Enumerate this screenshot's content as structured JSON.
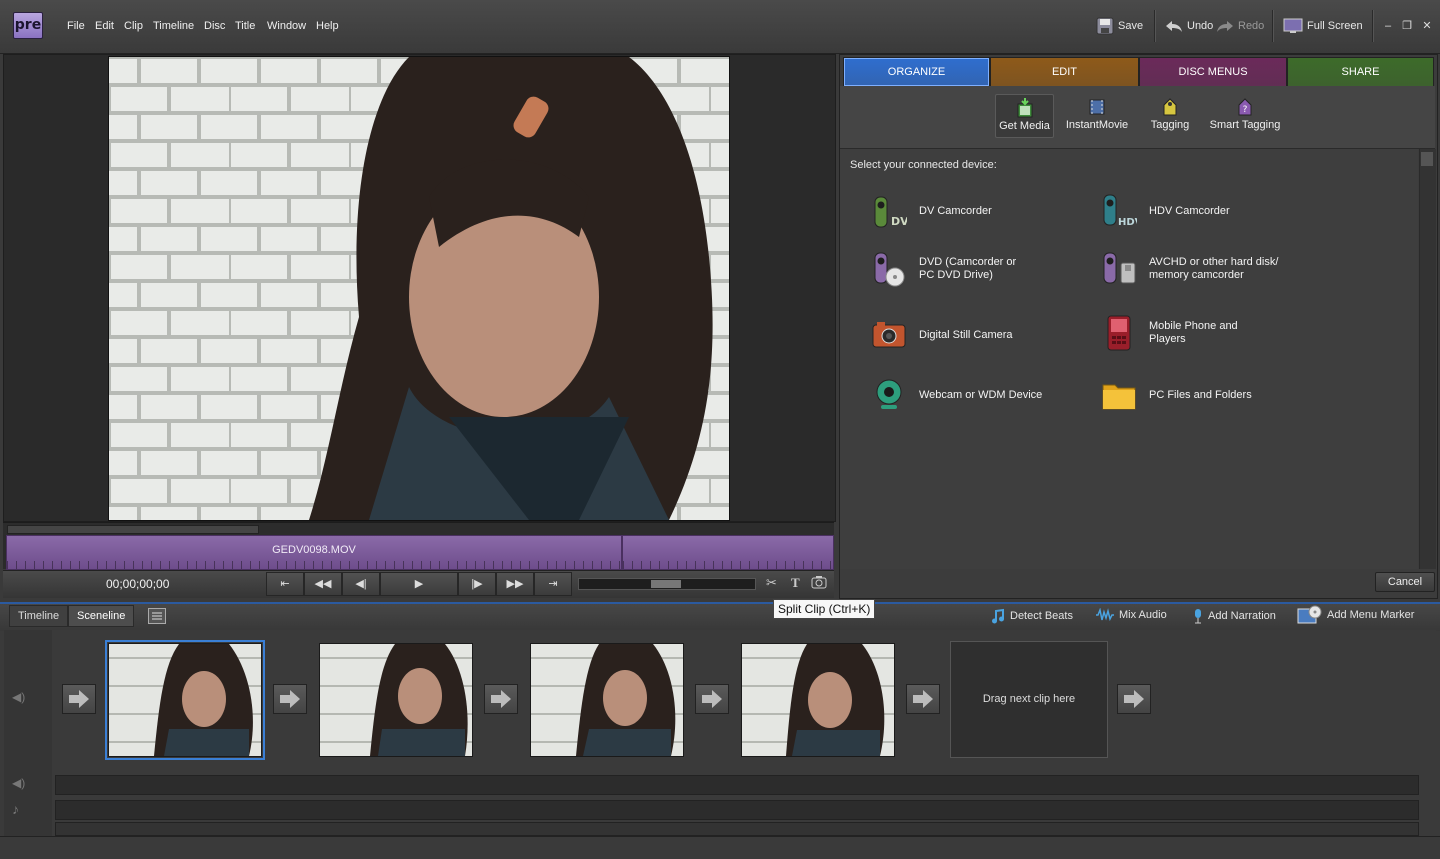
{
  "app": {
    "logo_text": "pre"
  },
  "menu": [
    "File",
    "Edit",
    "Clip",
    "Timeline",
    "Disc",
    "Title",
    "Window",
    "Help"
  ],
  "toolbar": {
    "save": "Save",
    "undo": "Undo",
    "redo": "Redo",
    "fullscreen": "Full Screen"
  },
  "monitor": {
    "clip_name": "GEDV0098.MOV",
    "timecode": "00;00;00;00"
  },
  "tabs": [
    {
      "label": "ORGANIZE",
      "color": "#2f6ecf",
      "active": true
    },
    {
      "label": "EDIT",
      "color": "#8e5a1a"
    },
    {
      "label": "DISC MENUS",
      "color": "#6b2a5a"
    },
    {
      "label": "SHARE",
      "color": "#3d6b2a"
    }
  ],
  "subtabs": [
    {
      "label": "Get Media",
      "icon": "get-media-icon",
      "active": true
    },
    {
      "label": "InstantMovie",
      "icon": "instant-movie-icon"
    },
    {
      "label": "Tagging",
      "icon": "tagging-icon"
    },
    {
      "label": "Smart Tagging",
      "icon": "smart-tagging-icon"
    }
  ],
  "device_prompt": "Select your connected device:",
  "devices": [
    {
      "label": "DV Camcorder",
      "icon": "dv-camcorder-icon"
    },
    {
      "label": "HDV Camcorder",
      "icon": "hdv-camcorder-icon"
    },
    {
      "label": "DVD (Camcorder or\nPC DVD Drive)",
      "icon": "dvd-icon"
    },
    {
      "label": "AVCHD or other hard disk/\nmemory camcorder",
      "icon": "avchd-icon"
    },
    {
      "label": "Digital Still Camera",
      "icon": "camera-icon"
    },
    {
      "label": "Mobile Phone and\nPlayers",
      "icon": "mobile-phone-icon"
    },
    {
      "label": "Webcam or WDM Device",
      "icon": "webcam-icon"
    },
    {
      "label": "PC Files and Folders",
      "icon": "folder-icon"
    }
  ],
  "cancel": "Cancel",
  "tooltip": "Split Clip (Ctrl+K)",
  "lower": {
    "tabs": [
      "Timeline",
      "Sceneline"
    ],
    "actions": [
      "Detect Beats",
      "Mix Audio",
      "Add Narration",
      "Add Menu Marker"
    ],
    "dropzone": "Drag next clip here"
  },
  "icon_labels": {
    "dv": "DV",
    "hdv": "HDV"
  },
  "colors": {
    "accent_blue": "#3a7fd5",
    "clip_purple": "#7b5a9b"
  }
}
